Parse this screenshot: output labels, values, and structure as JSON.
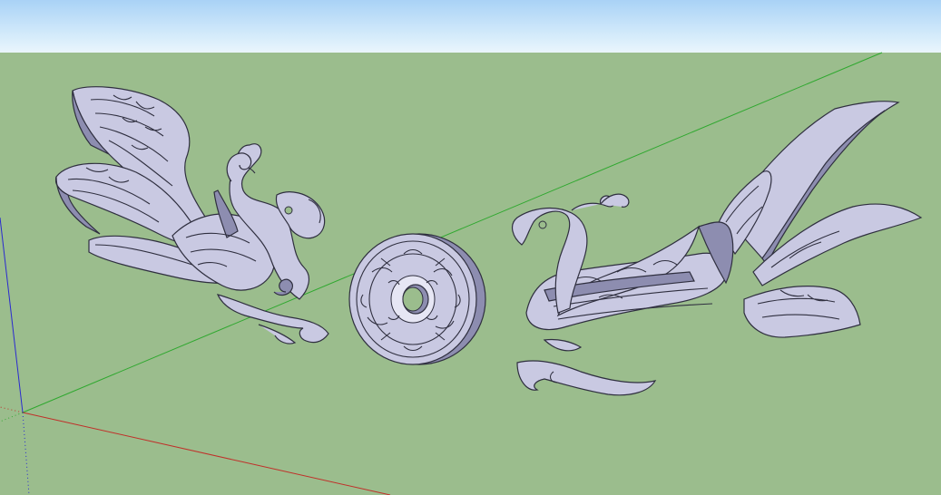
{
  "viewport": {
    "sky_color": "#d6ecfb",
    "ground_color": "#9bbd8d",
    "axis_colors": {
      "red": "#c0302a",
      "green": "#2fa82f",
      "blue": "#2a2ad0"
    }
  },
  "models": [
    {
      "name": "phoenix-left",
      "icon": "phoenix-model"
    },
    {
      "name": "round-medallion",
      "icon": "disc-model"
    },
    {
      "name": "phoenix-right",
      "icon": "phoenix-model"
    }
  ]
}
